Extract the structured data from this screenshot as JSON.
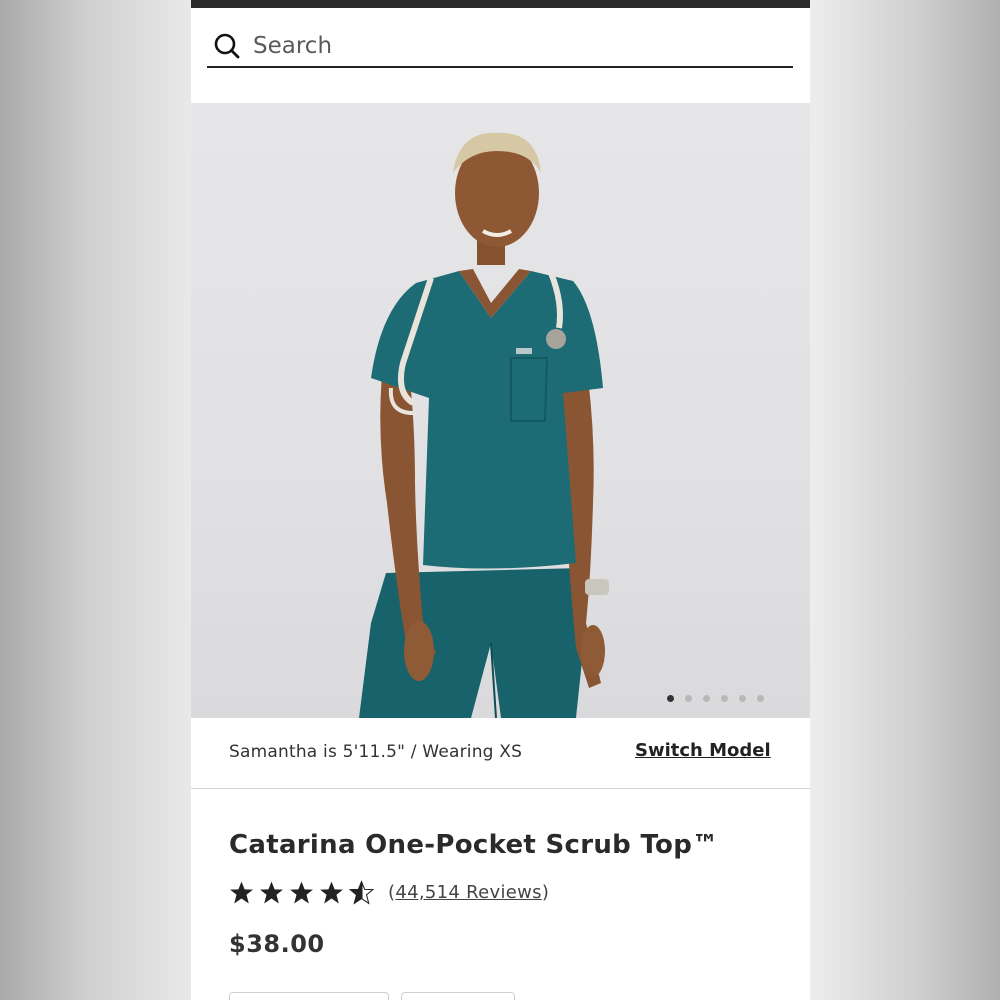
{
  "search": {
    "placeholder": "Search"
  },
  "product": {
    "model_info": "Samantha is 5'11.5\" / Wearing XS",
    "switch_model_label": "Switch Model",
    "title": "Catarina One-Pocket Scrub Top™",
    "rating": 4.5,
    "reviews_open": "(",
    "reviews_label": "44,514 Reviews",
    "reviews_close": ")",
    "price": "$38.00"
  },
  "carousel": {
    "total": 6,
    "active_index": 0
  },
  "colors": {
    "scrub": "#1d6b74",
    "text": "#2a2a2a",
    "accent_star": "#222222"
  }
}
